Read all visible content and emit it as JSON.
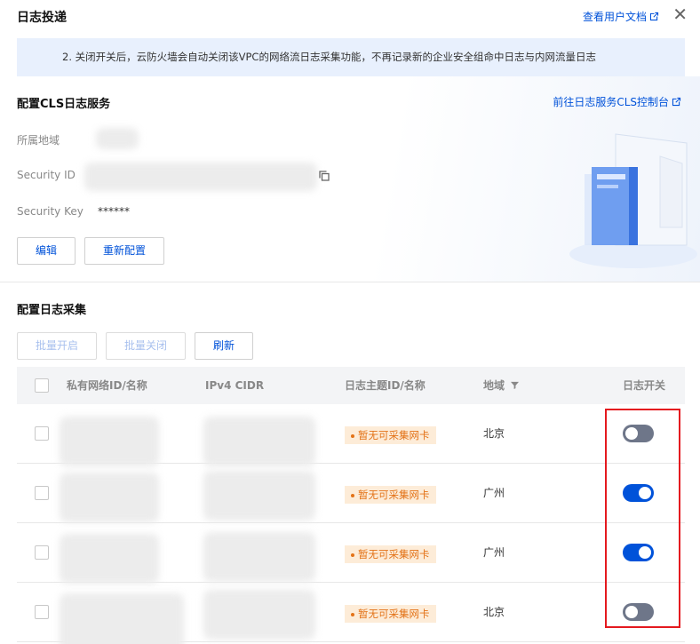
{
  "dialog": {
    "title": "日志投递",
    "doc_link": "查看用户文档",
    "notice": "2. 关闭开关后，云防火墙会自动关闭该VPC的网络流日志采集功能，不再记录新的企业安全组命中日志与内网流量日志"
  },
  "cls": {
    "title": "配置CLS日志服务",
    "console_link": "前往日志服务CLS控制台",
    "region_label": "所属地域",
    "security_id_label": "Security ID",
    "security_key_label": "Security Key",
    "security_key_value": "******",
    "edit_btn": "编辑",
    "reconfig_btn": "重新配置"
  },
  "log_collect": {
    "title": "配置日志采集",
    "batch_on": "批量开启",
    "batch_off": "批量关闭",
    "refresh": "刷新"
  },
  "table": {
    "headers": {
      "vpc": "私有网络ID/名称",
      "cidr": "IPv4 CIDR",
      "topic": "日志主题ID/名称",
      "region": "地域",
      "switch": "日志开关"
    },
    "rows": [
      {
        "topic": "暂无可采集网卡",
        "region": "北京",
        "enabled": false
      },
      {
        "topic": "暂无可采集网卡",
        "region": "广州",
        "enabled": true
      },
      {
        "topic": "暂无可采集网卡",
        "region": "广州",
        "enabled": true
      },
      {
        "topic": "暂无可采集网卡",
        "region": "北京",
        "enabled": false
      }
    ]
  },
  "colors": {
    "accent": "#0052d9",
    "warning": "#e37318",
    "highlight_box": "#e4191f"
  }
}
